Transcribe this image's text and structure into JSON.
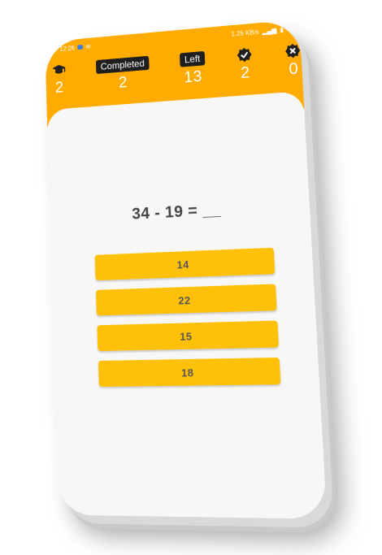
{
  "status_bar": {
    "time": "12:26",
    "right": "1.25 KB/s"
  },
  "header": {
    "level_value": "2",
    "completed_label": "Completed",
    "completed_value": "2",
    "left_label": "Left",
    "left_value": "13",
    "correct_value": "2",
    "wrong_value": "0"
  },
  "quiz": {
    "question": "34 - 19 = __",
    "answers": [
      "14",
      "22",
      "15",
      "18"
    ]
  },
  "colors": {
    "header": "#ffab00",
    "answer_button": "#ffc107",
    "tag_bg": "#1f1f1f"
  },
  "icons": [
    "graduation-cap-icon",
    "check-badge-icon",
    "close-badge-icon"
  ]
}
